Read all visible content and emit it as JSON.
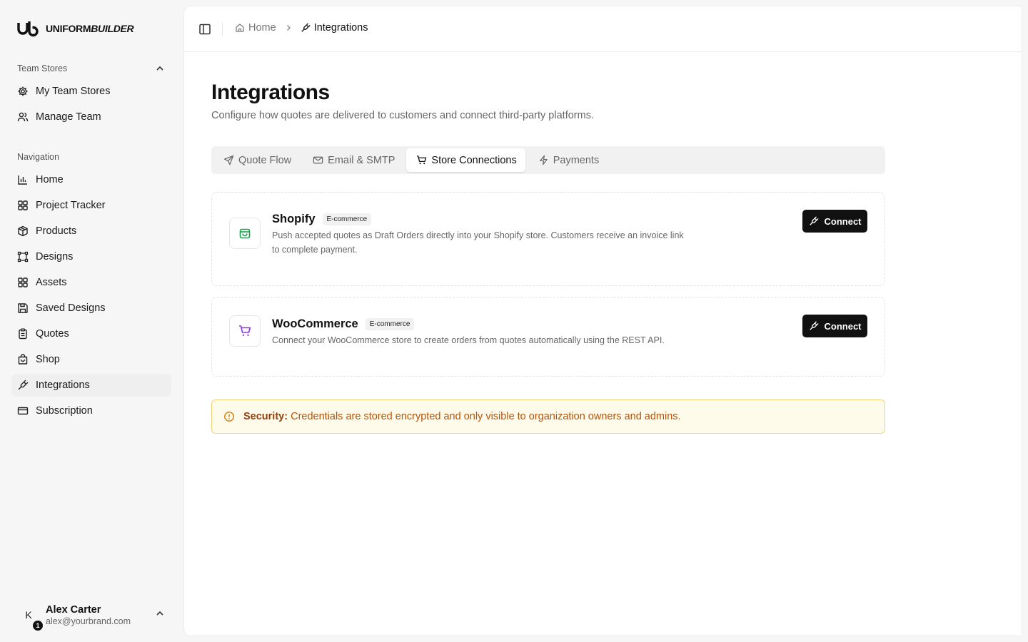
{
  "brand": {
    "name_regular": "UNIFORM",
    "name_bold": "BUILDER"
  },
  "sidebar": {
    "team_stores_label": "Team Stores",
    "team_items": [
      {
        "label": "My Team Stores",
        "icon": "gear-icon"
      },
      {
        "label": "Manage Team",
        "icon": "users-icon"
      }
    ],
    "navigation_label": "Navigation",
    "nav_items": [
      {
        "label": "Home",
        "icon": "bar-chart-icon"
      },
      {
        "label": "Project Tracker",
        "icon": "grid-icon"
      },
      {
        "label": "Products",
        "icon": "package-icon"
      },
      {
        "label": "Designs",
        "icon": "vector-square-icon"
      },
      {
        "label": "Assets",
        "icon": "grid-icon"
      },
      {
        "label": "Saved Designs",
        "icon": "save-icon"
      },
      {
        "label": "Quotes",
        "icon": "clipboard-icon"
      },
      {
        "label": "Shop",
        "icon": "store-icon"
      },
      {
        "label": "Integrations",
        "icon": "plug-icon",
        "active": true
      },
      {
        "label": "Subscription",
        "icon": "credit-card-icon"
      }
    ],
    "user": {
      "initial": "K",
      "badge": "1",
      "name": "Alex Carter",
      "email": "alex@yourbrand.com"
    }
  },
  "breadcrumb": {
    "home": "Home",
    "current": "Integrations"
  },
  "page": {
    "title": "Integrations",
    "subtitle": "Configure how quotes are delivered to customers and connect third-party platforms."
  },
  "tabs": [
    {
      "label": "Quote Flow",
      "icon": "send-icon"
    },
    {
      "label": "Email & SMTP",
      "icon": "mail-icon"
    },
    {
      "label": "Store Connections",
      "icon": "cart-icon",
      "active": true
    },
    {
      "label": "Payments",
      "icon": "zap-icon"
    }
  ],
  "integrations": [
    {
      "name": "Shopify",
      "tag": "E-commerce",
      "description": "Push accepted quotes as Draft Orders directly into your Shopify store. Customers receive an invoice link to complete payment.",
      "button": "Connect",
      "icon_color": "#16a34a"
    },
    {
      "name": "WooCommerce",
      "tag": "E-commerce",
      "description": "Connect your WooCommerce store to create orders from quotes automatically using the REST API.",
      "button": "Connect",
      "icon_color": "#9333ea"
    }
  ],
  "notice": {
    "label": "Security:",
    "text": "Credentials are stored encrypted and only visible to organization owners and admins."
  }
}
